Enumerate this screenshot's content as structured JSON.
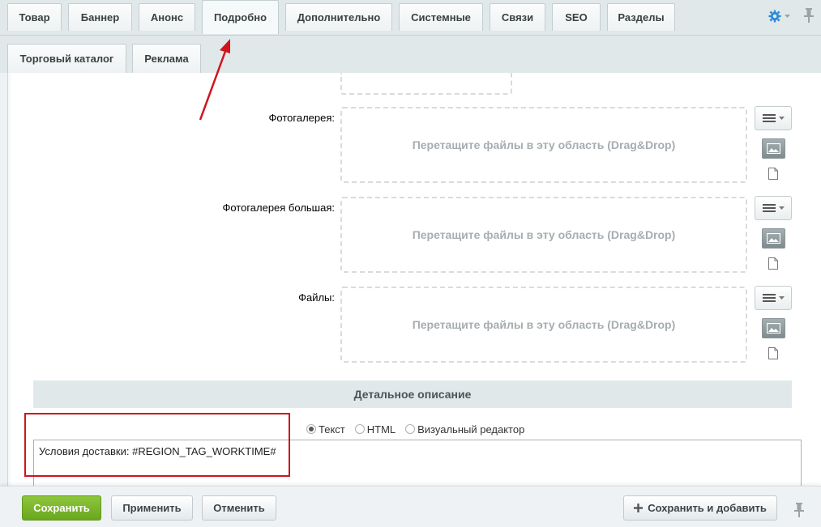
{
  "tabs": [
    {
      "label": "Товар"
    },
    {
      "label": "Баннер"
    },
    {
      "label": "Анонс"
    },
    {
      "label": "Подробно",
      "active": true
    },
    {
      "label": "Дополнительно"
    },
    {
      "label": "Системные"
    },
    {
      "label": "Связи"
    },
    {
      "label": "SEO"
    },
    {
      "label": "Разделы"
    }
  ],
  "tabs_row2": [
    {
      "label": "Торговый каталог"
    },
    {
      "label": "Реклама"
    }
  ],
  "fields": [
    {
      "label": "Фотогалерея:",
      "dropzone_text": "Перетащите файлы в эту область (Drag&Drop)"
    },
    {
      "label": "Фотогалерея большая:",
      "dropzone_text": "Перетащите файлы в эту область (Drag&Drop)"
    },
    {
      "label": "Файлы:",
      "dropzone_text": "Перетащите файлы в эту область (Drag&Drop)"
    }
  ],
  "detail": {
    "heading": "Детальное описание",
    "modes": [
      {
        "label": "Текст",
        "checked": true
      },
      {
        "label": "HTML",
        "checked": false
      },
      {
        "label": "Визуальный редактор",
        "checked": false
      }
    ],
    "text": "Условия доставки: #REGION_TAG_WORKTIME#"
  },
  "footer": {
    "save": "Сохранить",
    "apply": "Применить",
    "cancel": "Отменить",
    "save_add": "Сохранить и добавить"
  },
  "colors": {
    "accent_green": "#7ab52c",
    "annotation_red": "#d0141d",
    "gear_blue": "#2d8ad6"
  },
  "icons": [
    "gear-icon",
    "pin-icon",
    "menu-icon",
    "image-icon",
    "file-icon",
    "plus-icon",
    "radio-icon"
  ]
}
